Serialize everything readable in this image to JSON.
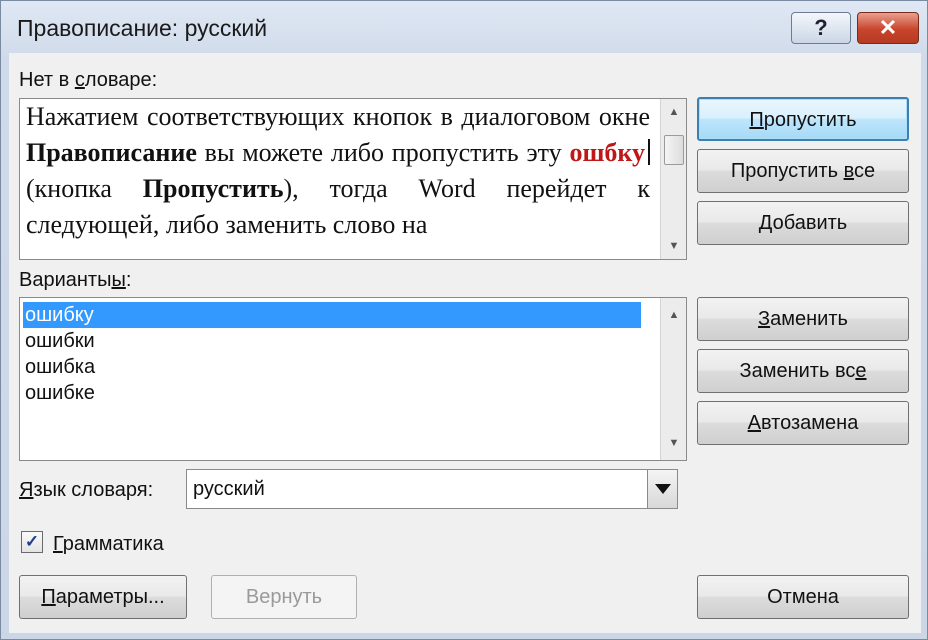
{
  "window": {
    "title": "Правописание: русский",
    "help_glyph": "?",
    "close_glyph": "✕"
  },
  "not_in_dictionary": {
    "label_prefix": "Нет в ",
    "label_accel": "с",
    "label_suffix": "ловаре:",
    "text_1": "Нажатием соответствующих кнопок в диалоговом окне ",
    "text_bold_1": "Правописание",
    "text_2": " вы можете либо пропустить эту ",
    "error_word": "ошбку",
    "text_3": " (кнопка ",
    "text_bold_2": "Пропустить",
    "text_4": "), тогда Word перейдет к следующей, либо заменить слово на"
  },
  "suggestions": {
    "label_prefix": "Варианты",
    "label_accel": "ы",
    "label_suffix": ":",
    "items": [
      "ошибку",
      "ошибки",
      "ошибка",
      "ошибке"
    ],
    "selected_index": 0
  },
  "buttons": {
    "skip_prefix": "",
    "skip_accel": "П",
    "skip_suffix": "ропустить",
    "skip_all_prefix": "Пропустить ",
    "skip_all_accel": "в",
    "skip_all_suffix": "се",
    "add_prefix": "",
    "add_accel": "Д",
    "add_suffix": "обавить",
    "replace_prefix": "",
    "replace_accel": "З",
    "replace_suffix": "аменить",
    "replace_all_prefix": "Заменить вс",
    "replace_all_accel": "е",
    "replace_all_suffix": "",
    "autocorrect_prefix": "",
    "autocorrect_accel": "А",
    "autocorrect_suffix": "втозамена",
    "options_prefix": "",
    "options_accel": "П",
    "options_suffix": "араметры...",
    "undo": "Вернуть",
    "cancel": "Отмена"
  },
  "dictionary_language": {
    "label_prefix": "",
    "label_accel": "Я",
    "label_suffix": "зык словаря:",
    "value": "русский"
  },
  "grammar": {
    "label_prefix": "",
    "label_accel": "Г",
    "label_suffix": "рамматика",
    "checked": true,
    "check_glyph": "✓"
  }
}
